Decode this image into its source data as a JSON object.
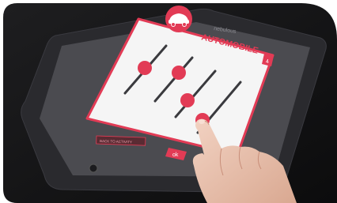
{
  "card": {
    "title": "AUTOMOBILE",
    "badge": "4",
    "ok_label": "ok"
  },
  "app_header_text": "nebulous",
  "footer_button_label": "BACK TO ACTIVITY",
  "sliders": [
    {
      "level": 0.6
    },
    {
      "level": 0.45
    },
    {
      "level": 0.2
    },
    {
      "level": 0.3
    },
    {
      "level": 0.05
    }
  ],
  "colors": {
    "accent": "#e23b55",
    "card_bg": "#f4f4f4",
    "tablet_body": "#2b2b2f",
    "screen_bg": "#4a4a4e",
    "background": "#151515"
  }
}
